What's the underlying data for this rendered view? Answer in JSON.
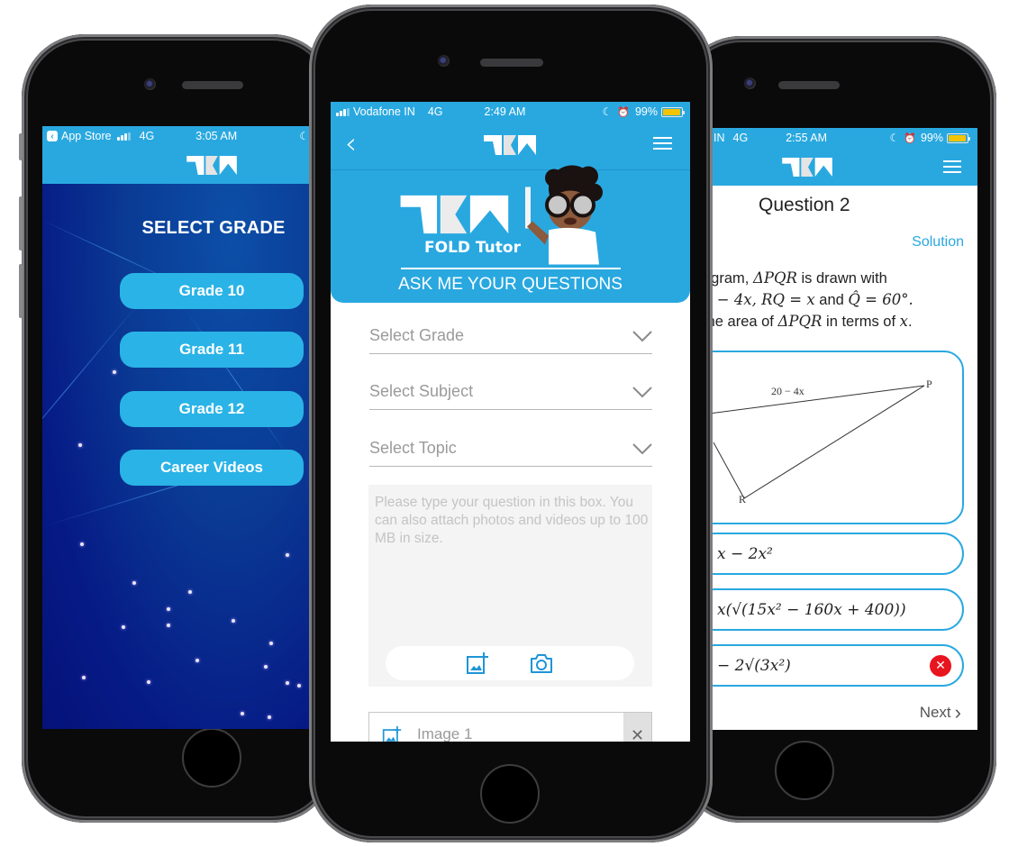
{
  "brand": {
    "primary_color": "#29a8e0",
    "logo_text": "TBN"
  },
  "left_phone": {
    "status_bar": {
      "back_app": "App Store",
      "network": "4G",
      "time": "3:05 AM"
    },
    "heading": "SELECT GRADE",
    "buttons": [
      {
        "label": "Grade 10"
      },
      {
        "label": "Grade 11"
      },
      {
        "label": "Grade 12"
      },
      {
        "label": "Career Videos"
      }
    ]
  },
  "middle_phone": {
    "status_bar": {
      "carrier": "Vodafone IN",
      "network": "4G",
      "time": "2:49 AM",
      "battery": "99%",
      "battery_level": 0.99
    },
    "banner": {
      "product_name": "FOLD Tutor",
      "tagline": "ASK ME YOUR QUESTIONS"
    },
    "selects": [
      {
        "placeholder": "Select Grade"
      },
      {
        "placeholder": "Select Subject"
      },
      {
        "placeholder": "Select Topic"
      }
    ],
    "question_box": {
      "placeholder": "Please type your question in this box. You can also attach photos and videos up to 100 MB in size."
    },
    "attachments": [
      {
        "label": "Image 1"
      }
    ]
  },
  "right_phone": {
    "status_bar": {
      "carrier_partial": "IN",
      "network": "4G",
      "time": "2:55 AM",
      "battery": "99%",
      "battery_level": 0.99
    },
    "question_title": "Question 2",
    "solution_link": "Solution",
    "question_lines": [
      [
        "agram, ",
        "ΔPQR",
        " is drawn with"
      ],
      [
        "0 − 4x,  RQ = x",
        " and ",
        "Q̂ = 60°."
      ],
      [
        "the area of ",
        "ΔPQR",
        " in terms of ",
        "x",
        "."
      ]
    ],
    "diagram": {
      "side_label": "20 − 4x",
      "vertex_p": "P",
      "vertex_r": "R"
    },
    "options": [
      {
        "text": "x − 2x²",
        "status": ""
      },
      {
        "text": "x(√(15x² − 160x + 400))",
        "status": ""
      },
      {
        "text": "− 2√(3x²)",
        "status": "wrong"
      }
    ],
    "next_label": "Next"
  }
}
